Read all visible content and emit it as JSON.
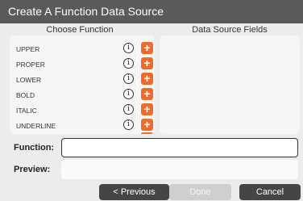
{
  "dialog": {
    "title": "Create A Function Data Source"
  },
  "columns": {
    "left": "Choose Function",
    "right": "Data Source Fields"
  },
  "functions": [
    {
      "label": "UPPER"
    },
    {
      "label": "PROPER"
    },
    {
      "label": "LOWER"
    },
    {
      "label": "BOLD"
    },
    {
      "label": "ITALIC"
    },
    {
      "label": "UNDERLINE"
    }
  ],
  "icons": {
    "info": "info-circle-icon",
    "add": "plus-icon",
    "info_glyph": "i",
    "add_glyph": "+"
  },
  "form": {
    "function_label": "Function:",
    "function_value": "",
    "preview_label": "Preview:",
    "preview_value": ""
  },
  "buttons": {
    "previous": "< Previous",
    "done": "Done",
    "cancel": "Cancel"
  },
  "colors": {
    "titlebar": "#5a5a5a",
    "accent": "#f26a2b",
    "field_focus_border": "#333333"
  }
}
